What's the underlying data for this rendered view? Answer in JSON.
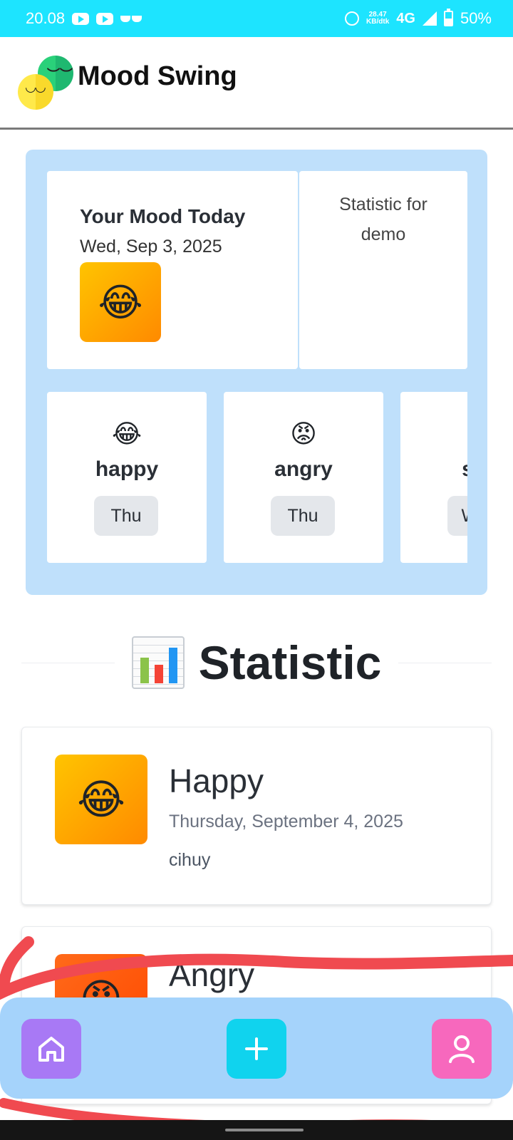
{
  "status_bar": {
    "time": "20.08",
    "speed_value": "28.47",
    "speed_unit": "KB/dtk",
    "network": "4G",
    "battery": "50%"
  },
  "app": {
    "title": "Mood Swing"
  },
  "today": {
    "title": "Your Mood Today",
    "date": "Wed, Sep 3, 2025",
    "emoji": "😂"
  },
  "statistic_card": {
    "line1": "Statistic for",
    "line2": "demo"
  },
  "week": [
    {
      "emoji": "😂",
      "label": "happy",
      "day": "Thu"
    },
    {
      "emoji": "😡",
      "label": "angry",
      "day": "Thu"
    },
    {
      "emoji": "😢",
      "label": "sad",
      "day": "Wed"
    }
  ],
  "section": {
    "heading": "Statistic"
  },
  "entries": [
    {
      "title": "Happy",
      "date": "Thursday, September 4, 2025",
      "note": "cihuy",
      "emoji": "😂"
    },
    {
      "title": "Angry",
      "emoji": "😡"
    }
  ],
  "colors": {
    "status_bar": "#1de4ff",
    "panel": "#bfe0fb",
    "nav_bar": "#a5d3fb",
    "home_button": "#a879f5",
    "add_button": "#10d3ee",
    "profile_button": "#f768bd",
    "happy_gradient_start": "#ffc400",
    "happy_gradient_end": "#ff8a00",
    "angry_gradient_start": "#ff6a1a",
    "angry_gradient_end": "#ff4a00"
  },
  "icons": {
    "home": "home-icon",
    "add": "plus-icon",
    "profile": "user-icon"
  }
}
